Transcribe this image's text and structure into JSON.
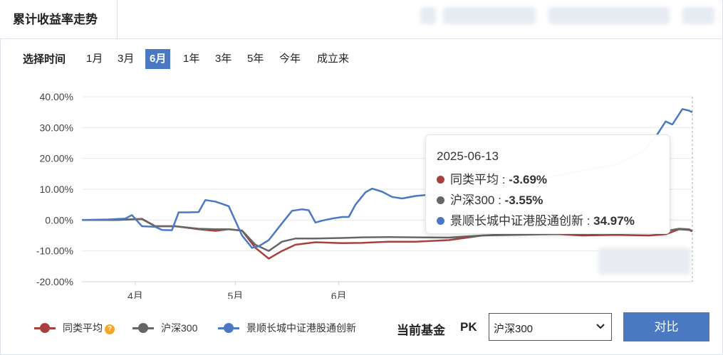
{
  "header": {
    "tab_title": "累计收益率走势"
  },
  "range": {
    "label": "选择时间",
    "options": [
      "1月",
      "3月",
      "6月",
      "1年",
      "3年",
      "5年",
      "今年",
      "成立来"
    ],
    "selected": "6月"
  },
  "tooltip": {
    "date": "2025-06-13",
    "rows": [
      {
        "name": "同类平均",
        "value": "-3.69%",
        "color": "#a8403f"
      },
      {
        "name": "沪深300",
        "value": "-3.55%",
        "color": "#666666"
      },
      {
        "name": "景顺长城中证港股通创新",
        "value": "34.97%",
        "color": "#4a79c2"
      }
    ]
  },
  "legend": {
    "items": [
      "同类平均",
      "沪深300",
      "景顺长城中证港股通创新"
    ]
  },
  "compare": {
    "current_label": "当前基金",
    "pk_label": "PK",
    "selected": "沪深300",
    "button_label": "对比"
  },
  "chart_data": {
    "type": "line",
    "y_ticks": [
      "40.00%",
      "30.00%",
      "20.00%",
      "10.00%",
      "0.00%",
      "-10.00%",
      "-20.00%"
    ],
    "x_ticks": [
      "4月",
      "5月",
      "6月"
    ],
    "ylim": [
      -20,
      40
    ],
    "colors": {
      "同类平均": "#a8403f",
      "沪深300": "#666666",
      "景顺长城中证港股通创新": "#4a79c2"
    },
    "series": [
      {
        "name": "同类平均",
        "color": "#a8403f",
        "points": [
          [
            0,
            0
          ],
          [
            10,
            0
          ],
          [
            18,
            0.4
          ],
          [
            22,
            -2
          ],
          [
            28,
            -2
          ],
          [
            35,
            -3
          ],
          [
            40,
            -3.5
          ],
          [
            44,
            -3
          ],
          [
            48,
            -3.4
          ],
          [
            52,
            -9
          ],
          [
            56,
            -12.5
          ],
          [
            60,
            -10
          ],
          [
            64,
            -8
          ],
          [
            70,
            -7.2
          ],
          [
            78,
            -7.5
          ],
          [
            84,
            -7.4
          ],
          [
            92,
            -7
          ],
          [
            100,
            -7
          ],
          [
            110,
            -6.5
          ],
          [
            120,
            -5
          ],
          [
            130,
            -4.5
          ],
          [
            140,
            -4.4
          ],
          [
            150,
            -5
          ],
          [
            160,
            -4.8
          ],
          [
            170,
            -5
          ],
          [
            175,
            -4.6
          ],
          [
            179,
            -3
          ],
          [
            182,
            -3.2
          ],
          [
            183,
            -3.69
          ]
        ]
      },
      {
        "name": "沪深300",
        "color": "#666666",
        "points": [
          [
            0,
            0
          ],
          [
            10,
            0
          ],
          [
            18,
            0.3
          ],
          [
            22,
            -2
          ],
          [
            28,
            -2
          ],
          [
            35,
            -2.8
          ],
          [
            40,
            -3
          ],
          [
            44,
            -3
          ],
          [
            48,
            -3.4
          ],
          [
            52,
            -8
          ],
          [
            56,
            -10
          ],
          [
            60,
            -7
          ],
          [
            64,
            -6
          ],
          [
            70,
            -6
          ],
          [
            78,
            -5.8
          ],
          [
            84,
            -5.6
          ],
          [
            92,
            -5.5
          ],
          [
            100,
            -5.6
          ],
          [
            110,
            -5.7
          ],
          [
            120,
            -5
          ],
          [
            130,
            -4.8
          ],
          [
            140,
            -4.6
          ],
          [
            150,
            -4.5
          ],
          [
            160,
            -4.2
          ],
          [
            170,
            -4
          ],
          [
            175,
            -3.6
          ],
          [
            179,
            -2.8
          ],
          [
            182,
            -3
          ],
          [
            183,
            -3.55
          ]
        ]
      },
      {
        "name": "景顺长城中证港股通创新",
        "color": "#4a79c2",
        "points": [
          [
            0,
            0
          ],
          [
            8,
            0.2
          ],
          [
            13,
            0.5
          ],
          [
            15,
            1.6
          ],
          [
            18,
            -2
          ],
          [
            22,
            -2.2
          ],
          [
            24,
            -3.2
          ],
          [
            27,
            -3.3
          ],
          [
            29,
            2.5
          ],
          [
            32,
            2.5
          ],
          [
            35,
            2.6
          ],
          [
            37,
            6.5
          ],
          [
            40,
            6
          ],
          [
            44,
            4.5
          ],
          [
            48,
            -5
          ],
          [
            51,
            -9
          ],
          [
            53,
            -8.5
          ],
          [
            56,
            -6.5
          ],
          [
            60,
            -1
          ],
          [
            63,
            3
          ],
          [
            66,
            3.5
          ],
          [
            68,
            3.2
          ],
          [
            70,
            -0.8
          ],
          [
            72,
            -0.2
          ],
          [
            75,
            0.5
          ],
          [
            78,
            1
          ],
          [
            80,
            1
          ],
          [
            82,
            5
          ],
          [
            85,
            9
          ],
          [
            87,
            10.2
          ],
          [
            90,
            9.2
          ],
          [
            93,
            7.5
          ],
          [
            96,
            7
          ],
          [
            100,
            7.8
          ],
          [
            104,
            8.2
          ],
          [
            108,
            8.2
          ],
          [
            120,
            8.5
          ],
          [
            130,
            12
          ],
          [
            140,
            14
          ],
          [
            150,
            16
          ],
          [
            160,
            18
          ],
          [
            168,
            22
          ],
          [
            172,
            27
          ],
          [
            175,
            32
          ],
          [
            177,
            31
          ],
          [
            180,
            36
          ],
          [
            182,
            35.5
          ],
          [
            183,
            34.97
          ]
        ]
      }
    ]
  }
}
